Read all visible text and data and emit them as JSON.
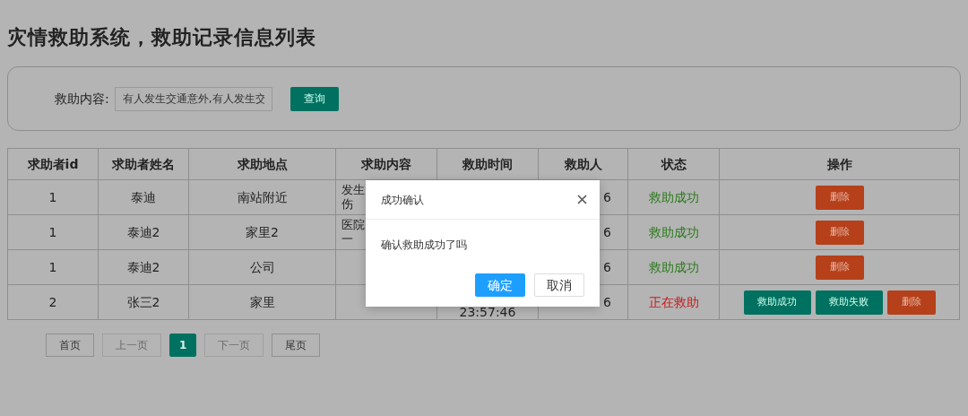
{
  "title": "灾情救助系统，救助记录信息列表",
  "search": {
    "label": "救助内容:",
    "value": "有人发生交通意外,有人发生交",
    "button": "查询"
  },
  "table": {
    "columns": [
      "求助者id",
      "求助者姓名",
      "求助地点",
      "求助内容",
      "救助时间",
      "救助人",
      "状态",
      "操作"
    ],
    "rows": [
      {
        "id": "1",
        "name": "泰迪",
        "place": "南站附近",
        "content": [
          "发生",
          "伤"
        ],
        "rescuer": "6",
        "status": {
          "text": "救助成功",
          "kind": "success"
        },
        "actions": [
          {
            "label": "删除",
            "kind": "delete"
          }
        ]
      },
      {
        "id": "1",
        "name": "泰迪2",
        "place": "家里2",
        "content": [
          "医院",
          "一"
        ],
        "rescuer": "6",
        "status": {
          "text": "救助成功",
          "kind": "success"
        },
        "actions": [
          {
            "label": "删除",
            "kind": "delete"
          }
        ]
      },
      {
        "id": "1",
        "name": "泰迪2",
        "place": "公司",
        "rescuer": "6",
        "status": {
          "text": "救助成功",
          "kind": "success"
        },
        "actions": [
          {
            "label": "删除",
            "kind": "delete"
          }
        ]
      },
      {
        "id": "2",
        "name": "张三2",
        "place": "家里",
        "time": "23:57:46",
        "rescuer": "6",
        "status": {
          "text": "正在救助",
          "kind": "ongoing"
        },
        "actions": [
          {
            "label": "救助成功",
            "kind": "confirm"
          },
          {
            "label": "救助失败",
            "kind": "confirm"
          },
          {
            "label": "删除",
            "kind": "delete"
          }
        ]
      }
    ]
  },
  "pagination": [
    {
      "label": "首页",
      "disabled": false,
      "selected": false
    },
    {
      "label": "上一页",
      "disabled": true,
      "selected": false
    },
    {
      "label": "1",
      "disabled": false,
      "selected": true
    },
    {
      "label": "下一页",
      "disabled": true,
      "selected": false
    },
    {
      "label": "尾页",
      "disabled": false,
      "selected": false
    }
  ],
  "dialog": {
    "title": "成功确认",
    "message": "确认救助成功了吗",
    "buttons": [
      {
        "label": "确定",
        "kind": "primary"
      },
      {
        "label": "取消",
        "kind": "secondary"
      }
    ]
  }
}
